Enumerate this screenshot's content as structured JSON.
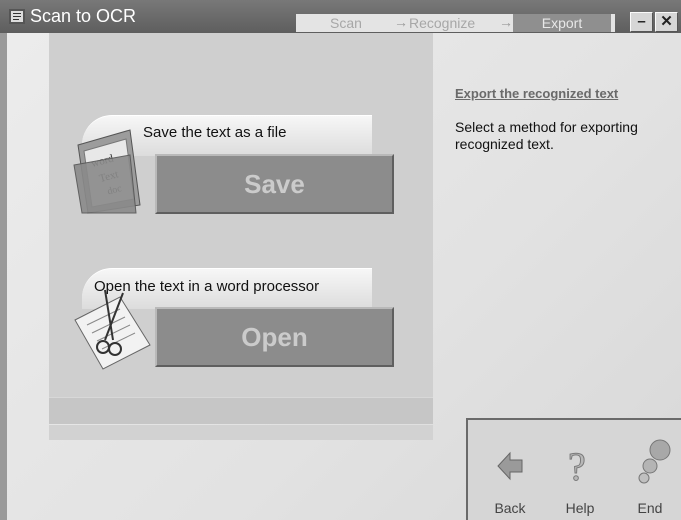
{
  "window": {
    "title": "Scan to OCR",
    "steps": [
      "Scan",
      "Recognize",
      "Export"
    ],
    "active_step": "Export"
  },
  "main": {
    "save": {
      "caption": "Save the text as a file",
      "button_label": "Save",
      "icon": "folder-icon"
    },
    "open": {
      "caption": "Open the text in a word processor",
      "button_label": "Open",
      "icon": "document-scissors-icon"
    }
  },
  "side": {
    "link": "Export the recognized text",
    "description": "Select a method for exporting recognized text."
  },
  "nav": {
    "back": {
      "label": "Back",
      "icon": "back-arrow-icon"
    },
    "help": {
      "label": "Help",
      "icon": "help-icon"
    },
    "end": {
      "label": "End",
      "icon": "end-icon"
    }
  },
  "colors": {
    "titlebar": "#666666",
    "button": "#8c8c8c",
    "button_text": "#cbcbcb"
  }
}
